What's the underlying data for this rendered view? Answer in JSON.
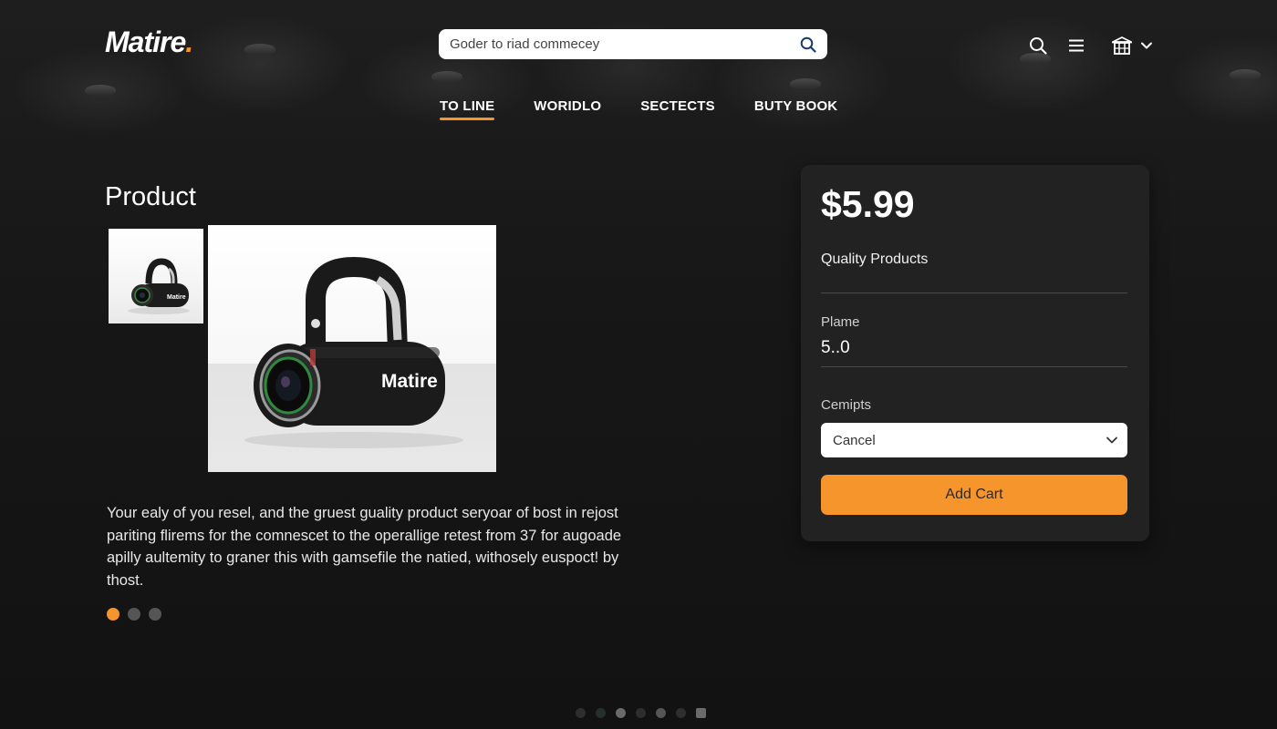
{
  "brand": {
    "logo_text": "Matire",
    "logo_dot": "."
  },
  "search": {
    "placeholder": "Goder to riad commecey"
  },
  "header_icons": [
    "search-icon",
    "hamburger-menu-icon",
    "store-icon",
    "chevron-down-icon"
  ],
  "nav": {
    "items": [
      {
        "label": "TO LINE",
        "active": true
      },
      {
        "label": "WORIDLO",
        "active": false
      },
      {
        "label": "SECTECTS",
        "active": false
      },
      {
        "label": "BUTY BOOK",
        "active": false
      }
    ]
  },
  "product": {
    "title": "Product",
    "image_brand": "Matire",
    "thumb_brand": "Matire",
    "description": "Your ealy of you resel, and the gruest guality product seryoar of bost in rejost pariting flirems for the comnescet to the operallige retest from 37 for augoade apilly aultemity to graner this with gamsefile the natied, withosely euspoct! by thost.",
    "carousel": {
      "count": 3,
      "active_index": 0
    }
  },
  "page_dots": {
    "count": 7
  },
  "purchase": {
    "price": "$5.99",
    "subtitle": "Quality Products",
    "field1_label": "Plame",
    "field1_value": "5..0",
    "field2_label": "Cemipts",
    "field2_selected": "Cancel",
    "add_cart_label": "Add Cart"
  },
  "colors": {
    "accent": "#f5952b",
    "background": "#161616",
    "panel": "#222222"
  }
}
